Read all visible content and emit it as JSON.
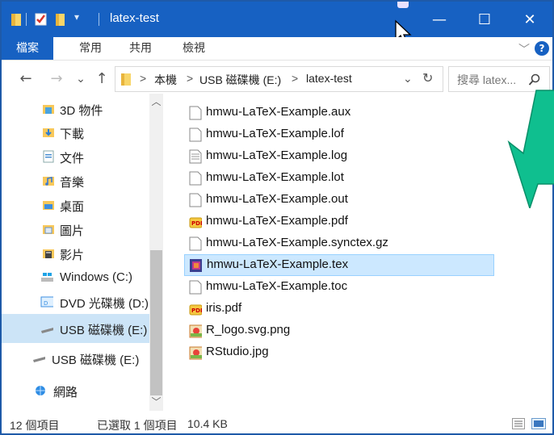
{
  "titlebar": {
    "title": "latex-test",
    "colors": {
      "bg": "#1761c2"
    },
    "buttons": {
      "minimize": "—",
      "maximize": "☐",
      "close": "✕"
    }
  },
  "ribbon": {
    "tabs": [
      {
        "label": "檔案",
        "active": true
      },
      {
        "label": "常用"
      },
      {
        "label": "共用"
      },
      {
        "label": "檢視"
      }
    ],
    "chevron": "﹀",
    "help": "?"
  },
  "address": {
    "back": "←",
    "forward": "→",
    "recent": "⌄",
    "up": "↑",
    "crumbs": [
      "本機",
      "USB 磁碟機 (E:)",
      "latex-test"
    ],
    "sep": ">",
    "dropdown": "⌄",
    "refresh": "↻",
    "search_placeholder": "搜尋 latex..."
  },
  "nav": {
    "items": [
      {
        "label": "3D 物件",
        "icon": "3d-objects-icon"
      },
      {
        "label": "下載",
        "icon": "downloads-icon"
      },
      {
        "label": "文件",
        "icon": "documents-icon"
      },
      {
        "label": "音樂",
        "icon": "music-icon"
      },
      {
        "label": "桌面",
        "icon": "desktop-icon"
      },
      {
        "label": "圖片",
        "icon": "pictures-icon"
      },
      {
        "label": "影片",
        "icon": "videos-icon"
      },
      {
        "label": "Windows (C:)",
        "icon": "windows-drive-icon"
      },
      {
        "label": "DVD 光碟機 (D:)",
        "icon": "dvd-drive-icon"
      },
      {
        "label": "USB 磁碟機 (E:)",
        "icon": "usb-drive-icon",
        "selected": true
      },
      {
        "label": "USB 磁碟機 (E:)",
        "icon": "usb-drive-icon"
      },
      {
        "label": "網路",
        "icon": "network-icon"
      }
    ],
    "scroll_up": "︿",
    "scroll_down": "﹀"
  },
  "files": [
    {
      "name": "hmwu-LaTeX-Example.aux",
      "icon": "blank-file-icon"
    },
    {
      "name": "hmwu-LaTeX-Example.lof",
      "icon": "blank-file-icon"
    },
    {
      "name": "hmwu-LaTeX-Example.log",
      "icon": "text-file-icon"
    },
    {
      "name": "hmwu-LaTeX-Example.lot",
      "icon": "blank-file-icon"
    },
    {
      "name": "hmwu-LaTeX-Example.out",
      "icon": "blank-file-icon"
    },
    {
      "name": "hmwu-LaTeX-Example.pdf",
      "icon": "pdf-file-icon"
    },
    {
      "name": "hmwu-LaTeX-Example.synctex.gz",
      "icon": "blank-file-icon"
    },
    {
      "name": "hmwu-LaTeX-Example.tex",
      "icon": "tex-file-icon",
      "selected": true
    },
    {
      "name": "hmwu-LaTeX-Example.toc",
      "icon": "blank-file-icon"
    },
    {
      "name": "iris.pdf",
      "icon": "pdf-file-icon"
    },
    {
      "name": "R_logo.svg.png",
      "icon": "image-file-icon"
    },
    {
      "name": "RStudio.jpg",
      "icon": "image-file-icon"
    }
  ],
  "status": {
    "count": "12 個項目",
    "selected": "已選取 1 個項目",
    "size": "10.4 KB"
  }
}
